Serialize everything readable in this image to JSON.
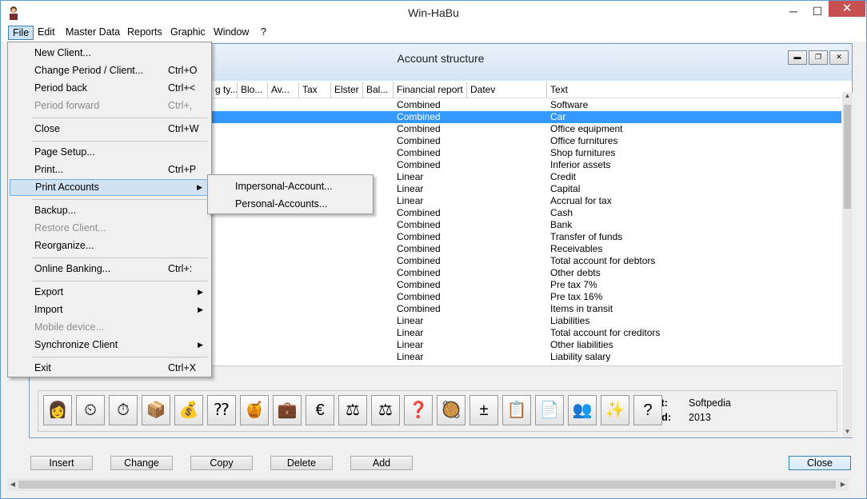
{
  "window": {
    "title": "Win-HaBu",
    "min_glyph": "─",
    "max_glyph": "☐",
    "close_glyph": "✕"
  },
  "menubar": [
    "File",
    "Edit",
    "Master Data",
    "Reports",
    "Graphic",
    "Window",
    "?"
  ],
  "child": {
    "title": "Account structure"
  },
  "table": {
    "headers": [
      "g ty...",
      "Blo...",
      "Av...",
      "Tax",
      "Elster",
      "Bal...",
      "Financial report",
      "Datev",
      "Text"
    ],
    "rows": [
      {
        "report": "Combined",
        "text": "Software"
      },
      {
        "report": "Combined",
        "text": "Car",
        "selected": true
      },
      {
        "report": "Combined",
        "text": "Office equipment"
      },
      {
        "report": "Combined",
        "text": "Office furnitures"
      },
      {
        "report": "Combined",
        "text": "Shop furnitures"
      },
      {
        "report": "Combined",
        "text": "Inferior assets"
      },
      {
        "report": "Linear",
        "text": "Credit"
      },
      {
        "report": "Linear",
        "text": "Capital"
      },
      {
        "report": "Linear",
        "text": "Accrual for tax"
      },
      {
        "report": "Combined",
        "text": "Cash"
      },
      {
        "report": "Combined",
        "text": "Bank"
      },
      {
        "report": "Combined",
        "text": "Transfer of funds"
      },
      {
        "report": "Combined",
        "text": "Receivables"
      },
      {
        "report": "Combined",
        "text": "Total account for debtors"
      },
      {
        "report": "Combined",
        "text": "Other debts"
      },
      {
        "report": "Combined",
        "text": "Pre tax 7%"
      },
      {
        "report": "Combined",
        "text": "Pre tax 16%"
      },
      {
        "report": "Combined",
        "text": "Items in transit"
      },
      {
        "report": "Linear",
        "text": "Liabilities"
      },
      {
        "report": "Linear",
        "text": "Total account for creditors"
      },
      {
        "report": "Linear",
        "text": "Other liabilities"
      },
      {
        "report": "Linear",
        "text": "Liability salary"
      }
    ]
  },
  "toolbar": {
    "icons": [
      {
        "name": "client-icon",
        "glyph": "👩"
      },
      {
        "name": "period-back-icon",
        "glyph": "⏲"
      },
      {
        "name": "period-forward-icon",
        "glyph": "⏱"
      },
      {
        "name": "transfer-icon",
        "glyph": "📦"
      },
      {
        "name": "coins-icon",
        "glyph": "💰"
      },
      {
        "name": "question-coins-icon",
        "glyph": "⁇"
      },
      {
        "name": "pots-icon",
        "glyph": "🍯"
      },
      {
        "name": "money-bag-icon",
        "glyph": "💼"
      },
      {
        "name": "euro-icon",
        "glyph": "€"
      },
      {
        "name": "scale-icon",
        "glyph": "⚖"
      },
      {
        "name": "seesaw-icon",
        "glyph": "⚖"
      },
      {
        "name": "question-icon",
        "glyph": "❓"
      },
      {
        "name": "bowl-icon",
        "glyph": "🥘"
      },
      {
        "name": "plus-minus-icon",
        "glyph": "±"
      },
      {
        "name": "form-icon",
        "glyph": "📋"
      },
      {
        "name": "document-icon",
        "glyph": "📄"
      },
      {
        "name": "users-icon",
        "glyph": "👥"
      },
      {
        "name": "wand-icon",
        "glyph": "✨"
      },
      {
        "name": "help-icon",
        "glyph": "?"
      }
    ],
    "client_label": "Client:",
    "client_value": "Softpedia",
    "period_label": "Period:",
    "period_value": "2013"
  },
  "buttons": {
    "insert": "Insert",
    "change": "Change",
    "copy": "Copy",
    "delete": "Delete",
    "add": "Add",
    "close": "Close"
  },
  "file_menu": [
    {
      "label": "New Client...",
      "shortcut": ""
    },
    {
      "label": "Change Period / Client...",
      "shortcut": "Ctrl+O"
    },
    {
      "label": "Period back",
      "shortcut": "Ctrl+<"
    },
    {
      "label": "Period forward",
      "shortcut": "Ctrl+,",
      "disabled": true
    },
    {
      "label": "Close",
      "shortcut": "Ctrl+W"
    },
    {
      "label": "Page Setup...",
      "shortcut": ""
    },
    {
      "label": "Print...",
      "shortcut": "Ctrl+P"
    },
    {
      "label": "Print Accounts",
      "shortcut": "",
      "submenu": true,
      "highlighted": true
    },
    {
      "label": "Backup...",
      "shortcut": ""
    },
    {
      "label": "Restore Client...",
      "shortcut": "",
      "disabled": true
    },
    {
      "label": "Reorganize...",
      "shortcut": ""
    },
    {
      "label": "Online Banking...",
      "shortcut": "Ctrl+:"
    },
    {
      "label": "Export",
      "shortcut": "",
      "submenu": true
    },
    {
      "label": "Import",
      "shortcut": "",
      "submenu": true
    },
    {
      "label": "Mobile device...",
      "shortcut": "",
      "disabled": true
    },
    {
      "label": "Synchronize Client",
      "shortcut": "",
      "submenu": true
    },
    {
      "label": "Exit",
      "shortcut": "Ctrl+X"
    }
  ],
  "submenu": [
    "Impersonal-Account...",
    "Personal-Accounts..."
  ]
}
